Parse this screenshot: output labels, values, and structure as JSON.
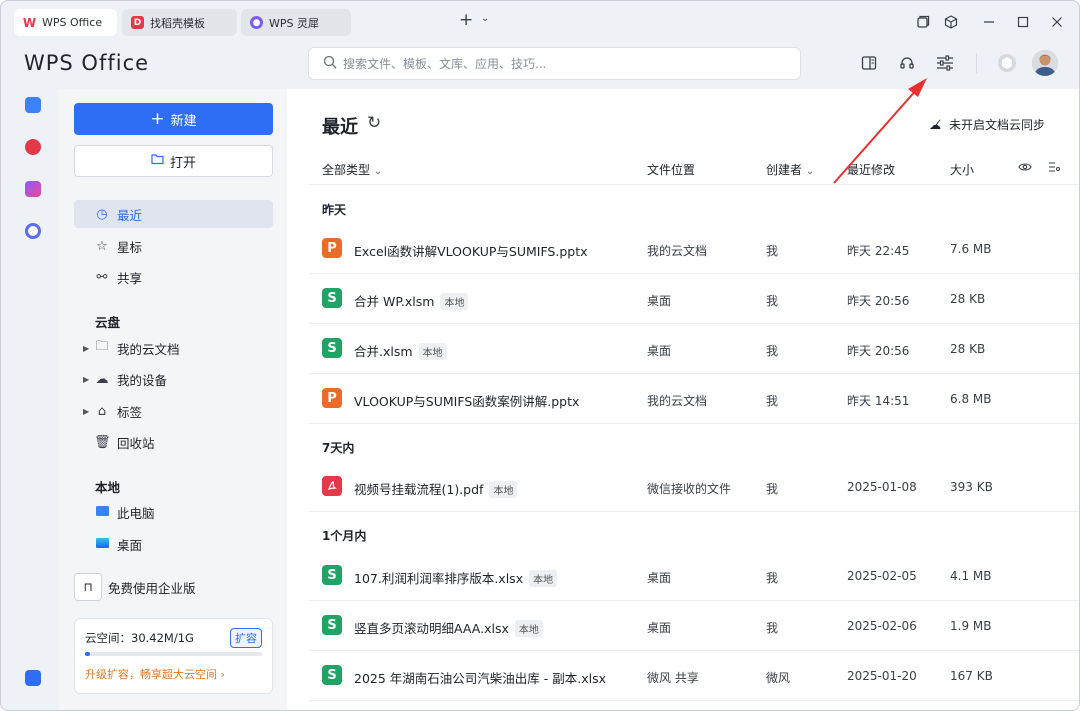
{
  "tabs": [
    {
      "label": "WPS Office",
      "icon": "wps-logo-icon"
    },
    {
      "label": "找稻壳模板",
      "icon": "docer-icon"
    },
    {
      "label": "WPS 灵犀",
      "icon": "lingxi-icon"
    }
  ],
  "header": {
    "logo": "WPS Office",
    "search_placeholder": "搜索文件、模板、文库、应用、技巧..."
  },
  "sidebar": {
    "new_label": "新建",
    "open_label": "打开",
    "nav": [
      {
        "label": "最近",
        "icon": "clock-icon"
      },
      {
        "label": "星标",
        "icon": "star-icon"
      },
      {
        "label": "共享",
        "icon": "share-icon"
      }
    ],
    "cloud_title": "云盘",
    "cloud": [
      {
        "label": "我的云文档",
        "icon": "folder-icon"
      },
      {
        "label": "我的设备",
        "icon": "cloud-device-icon"
      },
      {
        "label": "标签",
        "icon": "tag-icon"
      },
      {
        "label": "回收站",
        "icon": "trash-icon"
      }
    ],
    "local_title": "本地",
    "local": [
      {
        "label": "此电脑",
        "icon": "monitor-icon"
      },
      {
        "label": "桌面",
        "icon": "desktop-icon"
      }
    ],
    "enterprise_label": "免费使用企业版",
    "storage": {
      "text": "云空间：30.42M/1G",
      "expand": "扩容",
      "upgrade": "升级扩容，畅享超大云空间 ›",
      "used_fraction": 0.03
    }
  },
  "main": {
    "title": "最近",
    "sync_label": "未开启文档云同步",
    "columns": {
      "type": "全部类型",
      "location": "文件位置",
      "creator": "创建者",
      "modified": "最近修改",
      "size": "大小"
    },
    "groups": [
      {
        "label": "昨天",
        "files": [
          {
            "type": "p",
            "icon_letter": "P",
            "name": "Excel函数讲解VLOOKUP与SUMIFS.pptx",
            "badge": "",
            "location": "我的云文档",
            "creator": "我",
            "modified": "昨天 22:45",
            "size": "7.6 MB"
          },
          {
            "type": "s",
            "icon_letter": "S",
            "name": "合并 WP.xlsm",
            "badge": "本地",
            "location": "桌面",
            "creator": "我",
            "modified": "昨天 20:56",
            "size": "28 KB"
          },
          {
            "type": "s",
            "icon_letter": "S",
            "name": "合并.xlsm",
            "badge": "本地",
            "location": "桌面",
            "creator": "我",
            "modified": "昨天 20:56",
            "size": "28 KB"
          },
          {
            "type": "p",
            "icon_letter": "P",
            "name": "VLOOKUP与SUMIFS函数案例讲解.pptx",
            "badge": "",
            "location": "我的云文档",
            "creator": "我",
            "modified": "昨天 14:51",
            "size": "6.8 MB"
          }
        ]
      },
      {
        "label": "7天内",
        "files": [
          {
            "type": "d",
            "icon_letter": "",
            "name": "视频号挂载流程(1).pdf",
            "badge": "本地",
            "location": "微信接收的文件",
            "creator": "我",
            "modified": "2025-01-08",
            "size": "393 KB"
          }
        ]
      },
      {
        "label": "1个月内",
        "files": [
          {
            "type": "s",
            "icon_letter": "S",
            "name": "107.利润利润率排序版本.xlsx",
            "badge": "本地",
            "location": "桌面",
            "creator": "我",
            "modified": "2025-02-05",
            "size": "4.1 MB"
          },
          {
            "type": "s",
            "icon_letter": "S",
            "name": "竖直多页滚动明细AAA.xlsx",
            "badge": "本地",
            "location": "桌面",
            "creator": "我",
            "modified": "2025-02-06",
            "size": "1.9 MB"
          },
          {
            "type": "s",
            "icon_letter": "S",
            "name": "2025 年湖南石油公司汽柴油出库 - 副本.xlsx",
            "badge": "",
            "location": "微风 共享",
            "creator": "微风",
            "modified": "2025-01-20",
            "size": "167 KB"
          }
        ]
      }
    ]
  },
  "colors": {
    "accent": "#2d6ef5",
    "arrow": "#e8312f"
  }
}
